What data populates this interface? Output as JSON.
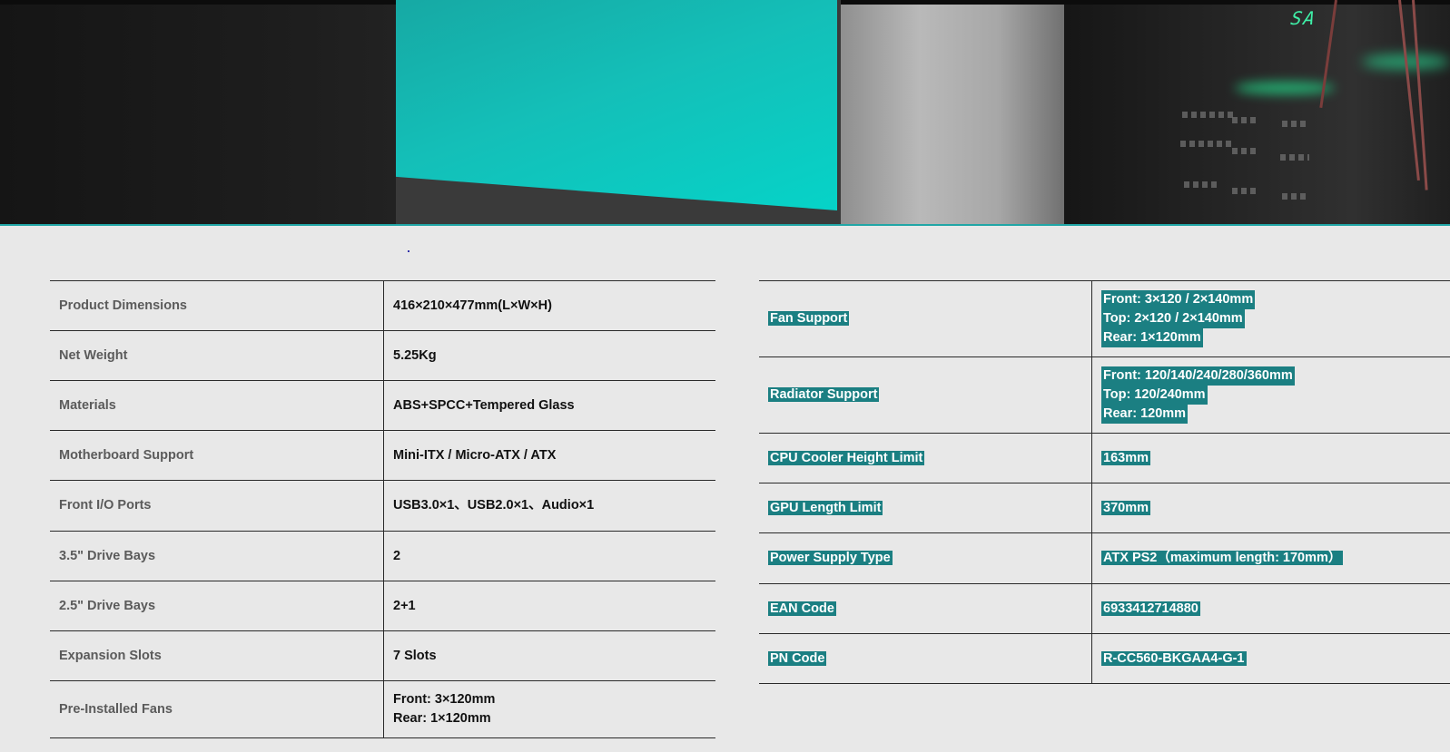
{
  "hero": {
    "brand_text": "SA",
    "image": "product-hero-image"
  },
  "specs_left": [
    {
      "label": "Product Dimensions",
      "value": "416×210×477mm(L×W×H)"
    },
    {
      "label": "Net Weight",
      "value": "5.25Kg"
    },
    {
      "label": "Materials",
      "value": "ABS+SPCC+Tempered Glass"
    },
    {
      "label": "Motherboard Support",
      "value": "Mini-ITX / Micro-ATX / ATX"
    },
    {
      "label": "Front I/O Ports",
      "value": "USB3.0×1、USB2.0×1、Audio×1"
    },
    {
      "label": "3.5\" Drive Bays",
      "value": "2"
    },
    {
      "label": "2.5\" Drive Bays",
      "value": "2+1"
    },
    {
      "label": "Expansion Slots",
      "value": "7 Slots"
    },
    {
      "label": "Pre-Installed Fans",
      "value": [
        "Front: 3×120mm",
        "Rear: 1×120mm"
      ]
    }
  ],
  "specs_right": [
    {
      "label": "Fan Support",
      "value": [
        "Front: 3×120 / 2×140mm",
        "Top: 2×120 / 2×140mm",
        "Rear: 1×120mm"
      ]
    },
    {
      "label": "Radiator Support",
      "value": [
        "Front: 120/140/240/280/360mm",
        "Top: 120/240mm",
        "Rear: 120mm"
      ]
    },
    {
      "label": "CPU Cooler Height Limit",
      "value": "163mm"
    },
    {
      "label": "GPU Length Limit",
      "value": "370mm"
    },
    {
      "label": "Power Supply Type",
      "value": "ATX PS2（maximum length: 170mm）"
    },
    {
      "label": "EAN Code",
      "value": "6933412714880"
    },
    {
      "label": "PN Code",
      "value": "R-CC560-BKGAA4-G-1"
    }
  ],
  "colors": {
    "highlight": "#1b7f82",
    "accent": "#21a6a6",
    "page_bg": "#e8e8e8"
  }
}
